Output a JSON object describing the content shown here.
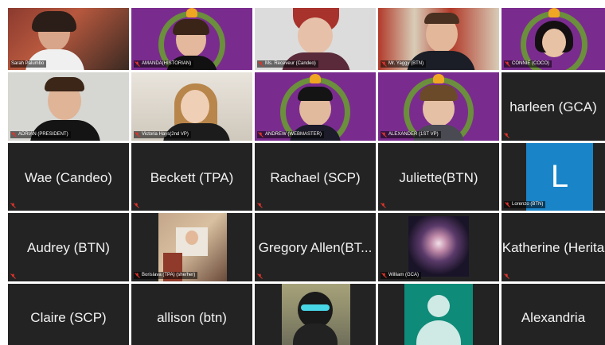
{
  "tiles": [
    {
      "name": "Sarah Palumbo"
    },
    {
      "name": "AMANDA(HISTORIAN)"
    },
    {
      "name": "Ms. Receveur (Candeo)"
    },
    {
      "name": "Mr. Yaggy (BTN)"
    },
    {
      "name": "CONNIE (COCO)"
    },
    {
      "name": "ADRIAN (PRESIDENT)"
    },
    {
      "name": "Victoria Hays(2nd VP)"
    },
    {
      "name": "ANDREW (WEBMASTER)"
    },
    {
      "name": "ALEXANDER (1ST VP)"
    },
    {
      "name": "harleen (GCA)"
    },
    {
      "name": "Wae (Candeo)"
    },
    {
      "name": "Beckett (TPA)"
    },
    {
      "name": "Rachael (SCP)"
    },
    {
      "name": "Juliette(BTN)"
    },
    {
      "name": "Lorenzo (BTN)",
      "avatar_letter": "L"
    },
    {
      "name": "Audrey (BTN)"
    },
    {
      "name": "Borislava (TPA) (she/her)"
    },
    {
      "name": "Gregory Allen(BT..."
    },
    {
      "name": "William (GCA)"
    },
    {
      "name": "Katherine (Herita"
    },
    {
      "name": "Claire (SCP)"
    },
    {
      "name": "allison (btn)"
    },
    {
      "name": ""
    },
    {
      "name": ""
    },
    {
      "name": "Alexandria"
    }
  ],
  "colors": {
    "tile_bg": "#232323",
    "muted_mic": "#e0352b",
    "laurel_purple": "#7a2c8e",
    "avatar_blue": "#1a84c8",
    "avatar_teal": "#0f8b79"
  },
  "icons": {
    "muted": "mic-muted-icon",
    "default_user": "person-icon"
  }
}
